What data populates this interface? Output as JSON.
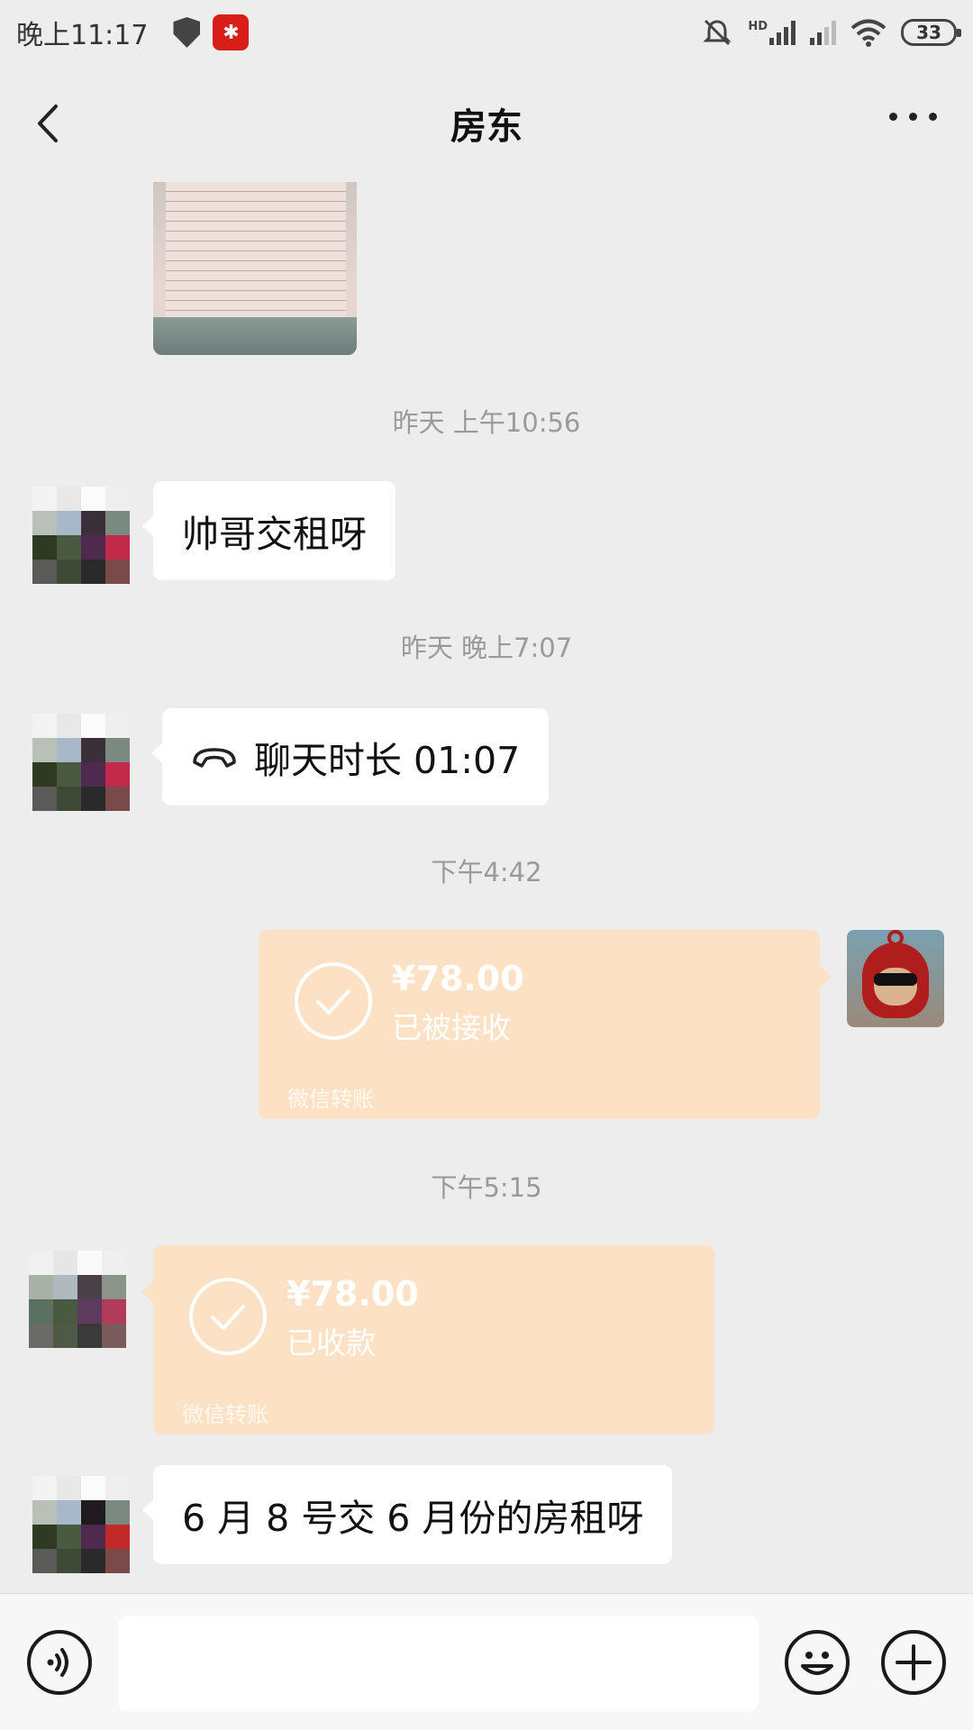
{
  "status_bar": {
    "time": "晚上11:17",
    "battery": "33",
    "network_label": "HD"
  },
  "nav": {
    "title": "房东",
    "back_icon": "chevron-left-icon",
    "more_icon": "more-icon"
  },
  "messages": {
    "ts1": "昨天 上午10:56",
    "msg1": "帅哥交租呀",
    "ts2": "昨天 晚上7:07",
    "call_text": "聊天时长 01:07",
    "ts3": "下午4:42",
    "transfer1": {
      "amount": "¥78.00",
      "status": "已被接收",
      "label": "微信转账"
    },
    "ts4": "下午5:15",
    "transfer2": {
      "amount": "¥78.00",
      "status": "已收款",
      "label": "微信转账"
    },
    "msg2": "6 月 8 号交 6 月份的房租呀"
  },
  "colors": {
    "background": "#ededed",
    "transfer_bubble": "#fce1c4",
    "bubble": "#ffffff"
  }
}
